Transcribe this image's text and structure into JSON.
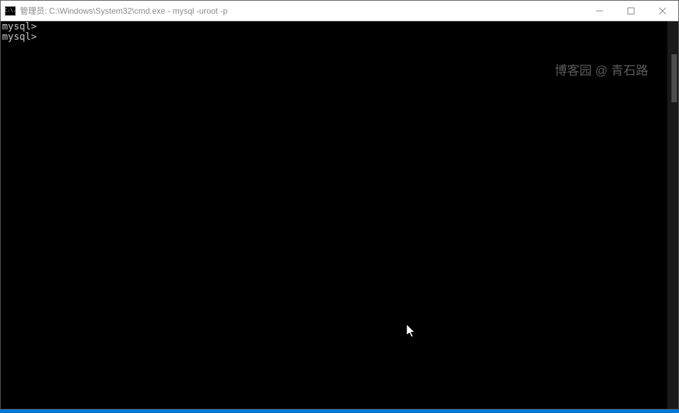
{
  "titlebar": {
    "icon_label": "C:\\.",
    "title": "管理员: C:\\Windows\\System32\\cmd.exe - mysql  -uroot -p"
  },
  "window_controls": {
    "minimize": "minimize",
    "maximize": "maximize",
    "close": "close"
  },
  "terminal": {
    "lines": [
      "mysql>",
      "mysql>"
    ]
  },
  "watermark": "博客园 @ 青石路"
}
